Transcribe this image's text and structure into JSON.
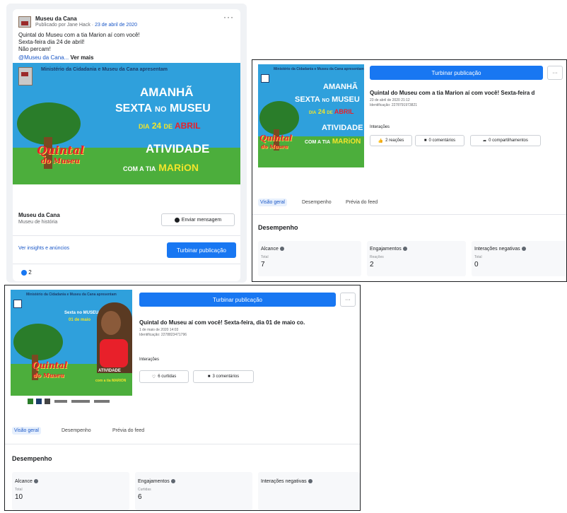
{
  "panel1": {
    "page_name": "Museu da Cana",
    "published": "Publicado por Jane Hack",
    "date": "23 de abril de 2020",
    "post_lines": [
      "Quintal do Museu com a tia Marion aí com você!",
      "Sexta-feira dia 24 de abril!",
      "Não percam!"
    ],
    "hashtag": "@Museu da Cana...",
    "see_more": "Ver mais",
    "page_name_footer": "Museu da Cana",
    "page_category": "Museu de história",
    "send_message": "Enviar mensagem",
    "insights_link": "Ver insights e anúncios",
    "boost": "Turbinar publicação",
    "reaction_count": "2"
  },
  "promo": {
    "header": "Ministério da Cidadania e Museu da Cana apresentam",
    "amanha": "AMANHÃ",
    "sexta": "SEXTA",
    "no": "NO",
    "museu": "MUSEU",
    "dia": "DIA",
    "date24": "24",
    "de": "DE",
    "abril": "ABRIL",
    "atividade": "ATIVIDADE",
    "com_a_tia": "COM A TIA",
    "marion": "MARiON",
    "quintal": "Quintal",
    "do_museu": "do Museu"
  },
  "panel2": {
    "boost": "Turbinar publicação",
    "title": "Quintal do Museu com a tia Marion aí com você! Sexta-feira d",
    "date_line": "23 de abril de 2020 21:12",
    "id_line": "Identificação: 2278791973821",
    "interactions": "Interações",
    "reactions": "2 reações",
    "comments": "0 comentários",
    "shares": "0 compartilhamentos",
    "tabs": [
      "Visão geral",
      "Desempenho",
      "Prévia do feed"
    ],
    "section": "Desempenho",
    "metrics": [
      {
        "label": "Alcance",
        "sub": "Total",
        "value": "7"
      },
      {
        "label": "Engajamentos",
        "sub": "Reações",
        "value": "2"
      },
      {
        "label": "Interações negativas",
        "sub": "Total",
        "value": "0"
      }
    ]
  },
  "panel3": {
    "boost": "Turbinar publicação",
    "title": "Quintal do Museu aí com você! Sexta-feira, dia 01 de maio co.",
    "date_line": "1 de maio de 2020 14:03",
    "id_line": "Identificação: 2278823471796",
    "interactions": "Interações",
    "reactions": "6 curtidas",
    "comments": "3 comentários",
    "tabs": [
      "Visão geral",
      "Desempenho",
      "Prévia do feed"
    ],
    "section": "Desempenho",
    "metrics": [
      {
        "label": "Alcance",
        "sub": "Total",
        "value": "10"
      },
      {
        "label": "Engajamentos",
        "sub": "Curtidas",
        "value": "6"
      },
      {
        "label": "Interações negativas",
        "sub": "",
        "value": ""
      }
    ],
    "thumb_header": "Ministério da Cidadania e Museu da Cana apresentam",
    "thumb_text1": "Sexta no MUSEU",
    "thumb_text2": "01 de maio",
    "thumb_atividade": "ATIVIDADE",
    "thumb_tia": "com a tia MARION"
  }
}
